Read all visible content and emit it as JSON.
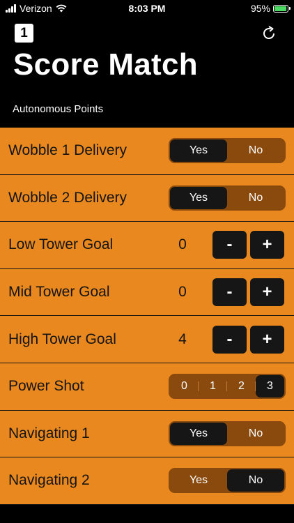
{
  "status_bar": {
    "carrier": "Verizon",
    "time": "8:03 PM",
    "battery": "95%",
    "battery_level": 0.95
  },
  "header": {
    "badge": "1",
    "title": "Score Match",
    "refresh_icon": "refresh-icon"
  },
  "section": {
    "title": "Autonomous Points"
  },
  "rows": {
    "wobble1": {
      "label": "Wobble 1 Delivery",
      "options": [
        "Yes",
        "No"
      ],
      "selected": "Yes"
    },
    "wobble2": {
      "label": "Wobble 2 Delivery",
      "options": [
        "Yes",
        "No"
      ],
      "selected": "Yes"
    },
    "low": {
      "label": "Low Tower Goal",
      "value": "0",
      "minus": "-",
      "plus": "+"
    },
    "mid": {
      "label": "Mid Tower Goal",
      "value": "0",
      "minus": "-",
      "plus": "+"
    },
    "high": {
      "label": "High Tower Goal",
      "value": "4",
      "minus": "-",
      "plus": "+"
    },
    "power": {
      "label": "Power Shot",
      "options": [
        "0",
        "1",
        "2",
        "3"
      ],
      "selected": "3"
    },
    "nav1": {
      "label": "Navigating 1",
      "options": [
        "Yes",
        "No"
      ],
      "selected": "Yes"
    },
    "nav2": {
      "label": "Navigating 2",
      "options": [
        "Yes",
        "No"
      ],
      "selected": "No"
    }
  },
  "colors": {
    "row_bg": "#e8881f",
    "segment_bg": "#8a4a0d",
    "selected": "#161616",
    "battery": "#4cd964"
  }
}
